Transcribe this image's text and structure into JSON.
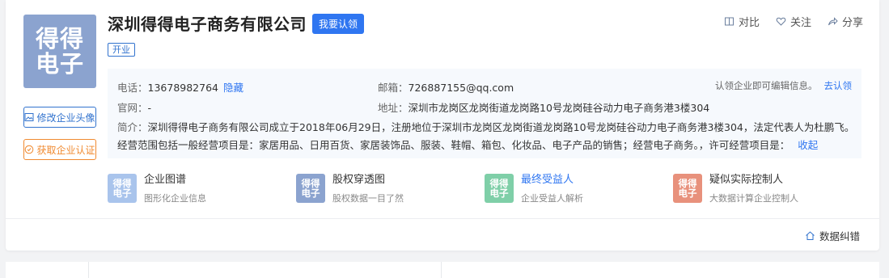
{
  "company": {
    "logo_lines": [
      "得得",
      "电子"
    ],
    "name": "深圳得得电子商务有限公司",
    "claim_button": "我要认领",
    "status_tag": "开业"
  },
  "side_buttons": {
    "edit_avatar": "修改企业头像",
    "get_certified": "获取企业认证"
  },
  "top_actions": {
    "compare": "对比",
    "follow": "关注",
    "share": "分享"
  },
  "info": {
    "phone_label": "电话：",
    "phone": "13678982764",
    "phone_hide": "隐藏",
    "email_label": "邮箱：",
    "email": "726887155@qq.com",
    "claim_note": "认领企业即可编辑信息。",
    "claim_link": "去认领",
    "website_label": "官网：",
    "website": "-",
    "address_label": "地址：",
    "address": "深圳市龙岗区龙岗街道龙岗路10号龙岗硅谷动力电子商务港3楼304",
    "intro_label": "简介：",
    "intro": "深圳得得电子商务有限公司成立于2018年06月29日，注册地位于深圳市龙岗区龙岗街道龙岗路10号龙岗硅谷动力电子商务港3楼304，法定代表人为杜鹏飞。经营范围包括一般经营项目是：家居用品、日用百货、家居装饰品、服装、鞋帽、箱包、化妆品、电子产品的销售；经营电子商务。，许可经营项目是：",
    "collapse": "收起"
  },
  "features": [
    {
      "icon": [
        "得得",
        "电子"
      ],
      "title": "企业图谱",
      "subtitle": "图形化企业信息",
      "color": "#a9c4ec"
    },
    {
      "icon": [
        "得得",
        "电子"
      ],
      "title": "股权穿透图",
      "subtitle": "股权数据一目了然",
      "color": "#8ba3cf"
    },
    {
      "icon": [
        "得得",
        "电子"
      ],
      "title": "最终受益人",
      "subtitle": "企业受益人解析",
      "color": "#7fcfa8"
    },
    {
      "icon": [
        "得得",
        "电子"
      ],
      "title": "疑似实际控制人",
      "subtitle": "大数据计算企业控制人",
      "color": "#e8917c"
    }
  ],
  "report_error": "数据纠错",
  "colors": {
    "brand_blue": "#2f76f1",
    "logo_bg": "#8ba3cf",
    "cert_orange": "#f08a30"
  }
}
